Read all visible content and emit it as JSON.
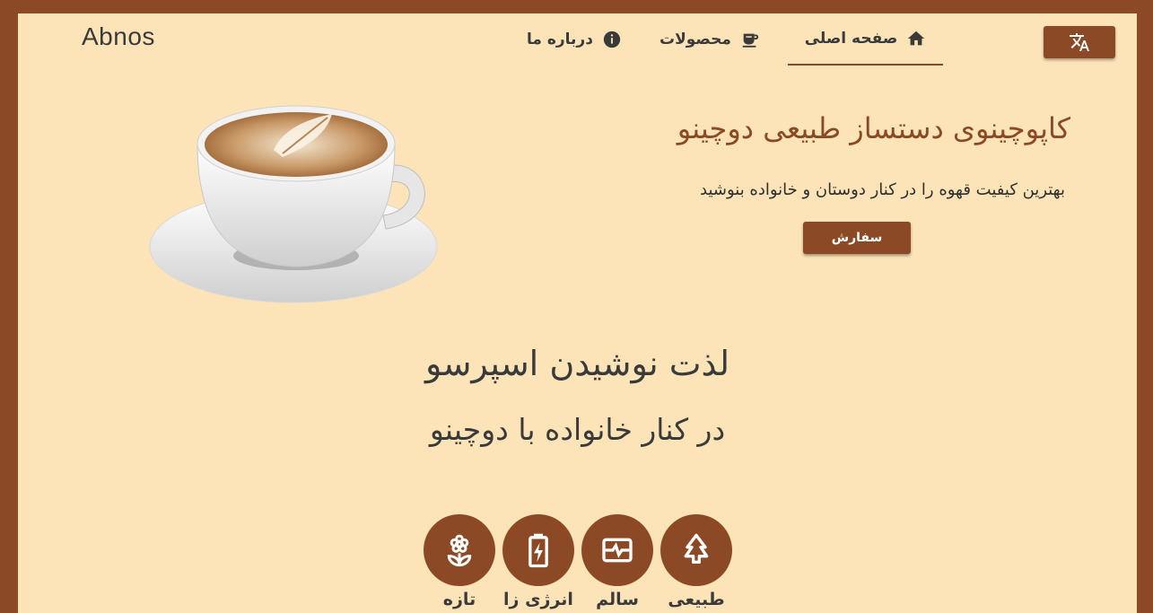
{
  "header": {
    "logo": "Abnos",
    "nav": [
      {
        "label": "صفحه اصلی",
        "icon": "home-icon",
        "active": true
      },
      {
        "label": "محصولات",
        "icon": "coffee-icon",
        "active": false
      },
      {
        "label": "درباره ما",
        "icon": "info-icon",
        "active": false
      }
    ],
    "lang_icon": "translate-icon"
  },
  "hero": {
    "title": "کاپوچینوی دستساز طبیعی دوچینو",
    "subtitle": "بهترین کیفیت قهوه را در کنار دوستان و خانواده بنوشید",
    "order_label": "سفارش",
    "image": "cappuccino-cup"
  },
  "tagline": {
    "line1": "لذت نوشیدن اسپرسو",
    "line2": "در کنار خانواده با دوچینو"
  },
  "features": [
    {
      "label": "طبیعی",
      "icon": "tree-icon"
    },
    {
      "label": "سالم",
      "icon": "health-pulse-icon"
    },
    {
      "label": "انرژی زا",
      "icon": "battery-charging-icon"
    },
    {
      "label": "تازه",
      "icon": "flower-icon"
    }
  ],
  "colors": {
    "accent": "#8b4a25",
    "background": "#fde4b8",
    "text": "#3a3a3a"
  }
}
